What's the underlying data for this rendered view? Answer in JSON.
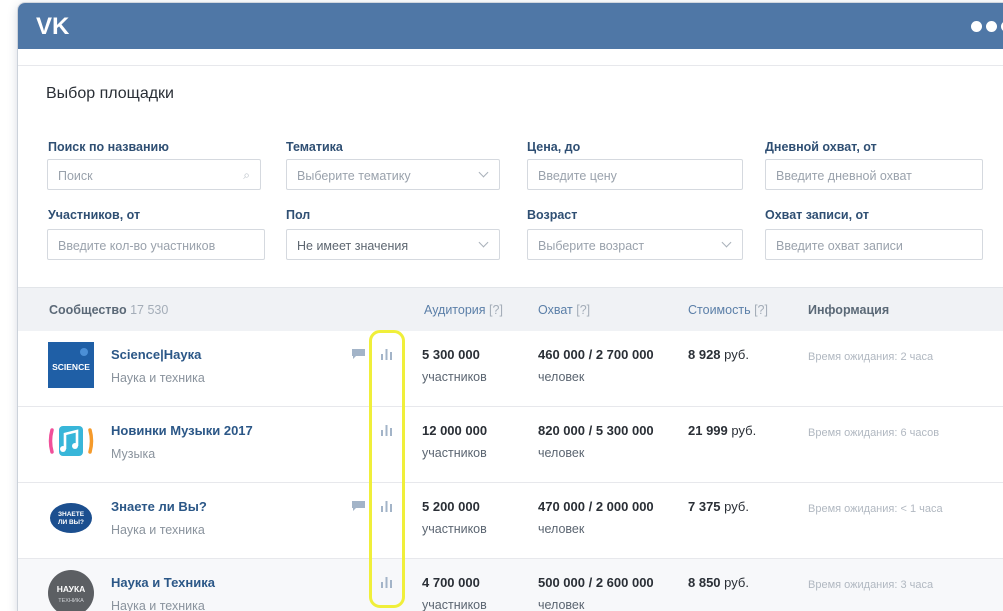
{
  "app": {
    "logo": "VK"
  },
  "page": {
    "title": "Выбор площадки"
  },
  "filters": {
    "search": {
      "label": "Поиск по названию",
      "placeholder": "Поиск"
    },
    "topic": {
      "label": "Тематика",
      "placeholder": "Выберите тематику"
    },
    "price": {
      "label": "Цена, до",
      "placeholder": "Введите цену"
    },
    "daily_reach": {
      "label": "Дневной охват, от",
      "placeholder": "Введите дневной охват"
    },
    "members": {
      "label": "Участников, от",
      "placeholder": "Введите кол-во участников"
    },
    "gender": {
      "label": "Пол",
      "value": "Не имеет значения"
    },
    "age": {
      "label": "Возраст",
      "placeholder": "Выберите возраст"
    },
    "post_reach": {
      "label": "Охват записи, от",
      "placeholder": "Введите охват записи"
    }
  },
  "table": {
    "headers": {
      "community": "Сообщество",
      "community_count": "17 530",
      "audience": "Аудитория",
      "reach": "Охват",
      "cost": "Стоимость",
      "help_mark": "[?]",
      "info": "Информация"
    },
    "rows": [
      {
        "name": "Science|Наука",
        "category": "Наука и техника",
        "avatar_text": "SCIENCE",
        "audience": "5 300 000",
        "audience_unit": "участников",
        "reach": "460 000 / 2 700 000",
        "reach_unit": "человек",
        "price": "8 928",
        "currency": "руб.",
        "info": "Время ожидания: 2 часа"
      },
      {
        "name": "Новинки Музыки 2017",
        "category": "Музыка",
        "avatar_text": "",
        "audience": "12 000 000",
        "audience_unit": "участников",
        "reach": "820 000 / 5 300 000",
        "reach_unit": "человек",
        "price": "21 999",
        "currency": "руб.",
        "info": "Время ожидания: 6 часов"
      },
      {
        "name": "Знаете ли Вы?",
        "category": "Наука и техника",
        "avatar_text": "ЗНАЕТЕ ЛИ ВЫ?",
        "audience": "5 200 000",
        "audience_unit": "участников",
        "reach": "470 000 / 2 000 000",
        "reach_unit": "человек",
        "price": "7 375",
        "currency": "руб.",
        "info": "Время ожидания: < 1 часа"
      },
      {
        "name": "Наука и Техника",
        "category": "Наука и техника",
        "avatar_text": "НАУКА",
        "avatar_subtext": "ТЕХНИКА",
        "audience": "4 700 000",
        "audience_unit": "участников",
        "reach": "500 000 / 2 600 000",
        "reach_unit": "человек",
        "price": "8 850",
        "currency": "руб.",
        "info": "Время ожидания: 3 часа"
      }
    ]
  },
  "colors": {
    "topbar": "#4f77a6",
    "link": "#2b5787",
    "highlight": "#f0ef3a"
  },
  "icons": [
    "vk-logo",
    "search-icon",
    "chevron-down-icon",
    "comment-icon",
    "stats-icon",
    "more-dots-icon"
  ]
}
